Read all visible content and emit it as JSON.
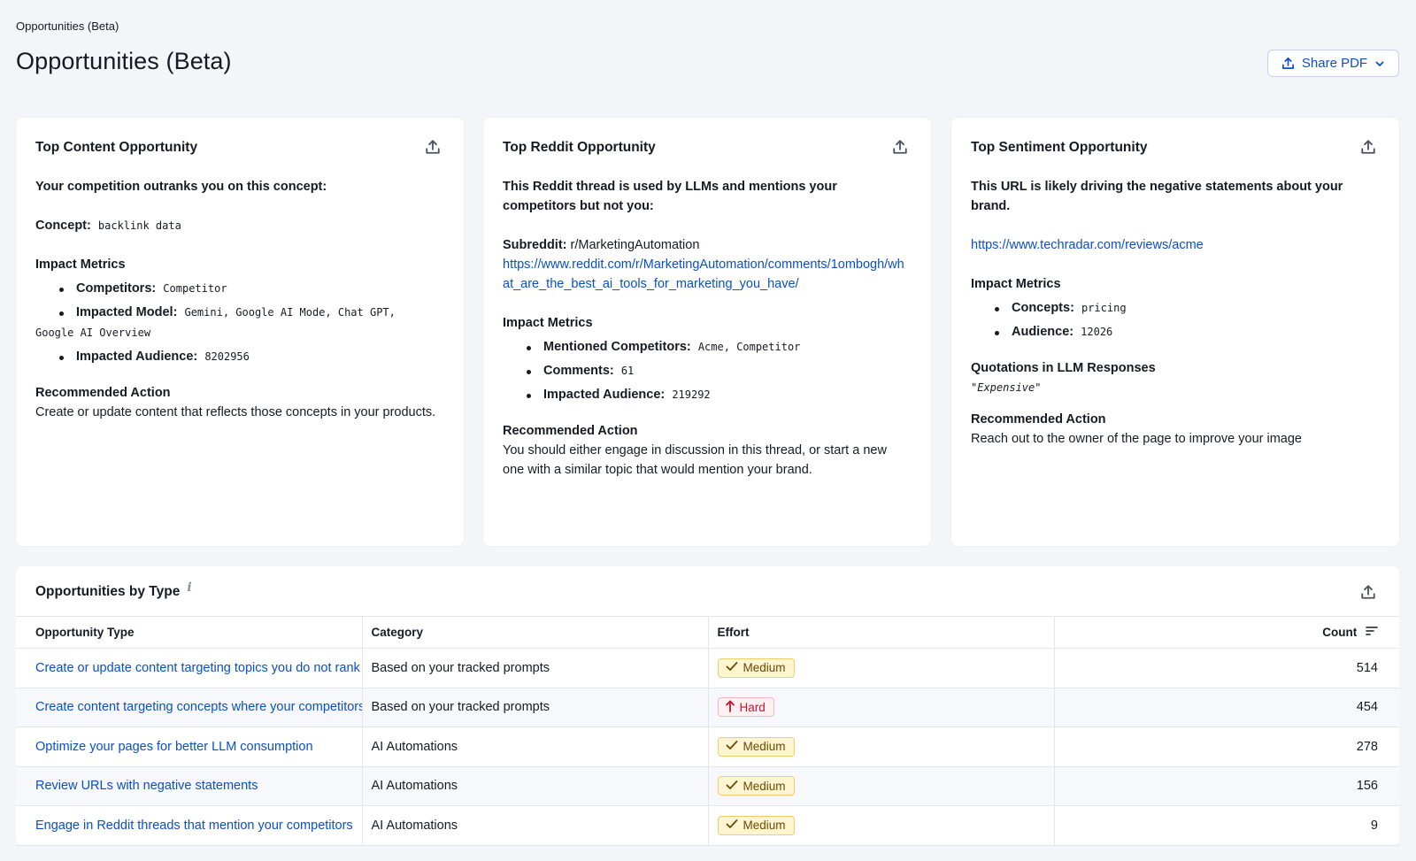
{
  "breadcrumb": "Opportunities (Beta)",
  "title": "Opportunities (Beta)",
  "share_button": {
    "label": "Share PDF",
    "icon": "upload-icon",
    "accent": "#0a4fc8"
  },
  "cards": {
    "content": {
      "title": "Top Content Opportunity",
      "intro": "Your competition outranks you on this concept:",
      "concept_label": "Concept:",
      "concept_value": "backlink data",
      "metrics_heading": "Impact Metrics",
      "metrics": {
        "competitors_label": "Competitors:",
        "competitors_value": "Competitor",
        "model_label": "Impacted Model:",
        "model_value_1": "Gemini, Google AI Mode, Chat GPT,",
        "model_value_2": "Google AI Overview",
        "audience_label": "Impacted Audience:",
        "audience_value": "8202956"
      },
      "action_heading": "Recommended Action",
      "action_text": "Create or update content that reflects those concepts in your products."
    },
    "reddit": {
      "title": "Top Reddit Opportunity",
      "intro": "This Reddit thread is used by LLMs and mentions your competitors but not you:",
      "subreddit_label": "Subreddit:",
      "subreddit_value": "r/MarketingAutomation",
      "thread_url": "https://www.reddit.com/r/MarketingAutomation/comments/1ombogh/what_are_the_best_ai_tools_for_marketing_you_have/",
      "metrics_heading": "Impact Metrics",
      "metrics": {
        "mentioned_label": "Mentioned Competitors:",
        "mentioned_value": "Acme, Competitor",
        "comments_label": "Comments:",
        "comments_value": "61",
        "audience_label": "Impacted Audience:",
        "audience_value": "219292"
      },
      "action_heading": "Recommended Action",
      "action_text": "You should either engage in discussion in this thread, or start a new one with a similar topic that would mention your brand."
    },
    "sentiment": {
      "title": "Top Sentiment Opportunity",
      "intro": "This URL is likely driving the negative statements about your brand.",
      "url": "https://www.techradar.com/reviews/acme",
      "metrics_heading": "Impact Metrics",
      "metrics": {
        "concepts_label": "Concepts:",
        "concepts_value": "pricing",
        "audience_label": "Audience:",
        "audience_value": "12026"
      },
      "quotes_heading": "Quotations in LLM Responses",
      "quote": "\"Expensive\"",
      "action_heading": "Recommended Action",
      "action_text": "Reach out to the owner of the page to improve your image"
    }
  },
  "table": {
    "title": "Opportunities by Type",
    "info_icon": "info-icon",
    "columns": {
      "type": "Opportunity Type",
      "category": "Category",
      "effort": "Effort",
      "count": "Count"
    },
    "rows": [
      {
        "type": "Create or update content targeting topics you do not rank for",
        "category": "Based on your tracked prompts",
        "effort": "Medium",
        "count": "514"
      },
      {
        "type": "Create content targeting concepts where your competitors outrank you",
        "category": "Based on your tracked prompts",
        "effort": "Hard",
        "count": "454"
      },
      {
        "type": "Optimize your pages for better LLM consumption",
        "category": "AI Automations",
        "effort": "Medium",
        "count": "278"
      },
      {
        "type": "Review URLs with negative statements",
        "category": "AI Automations",
        "effort": "Medium",
        "count": "156"
      },
      {
        "type": "Engage in Reddit threads that mention your competitors",
        "category": "AI Automations",
        "effort": "Medium",
        "count": "9"
      }
    ]
  }
}
